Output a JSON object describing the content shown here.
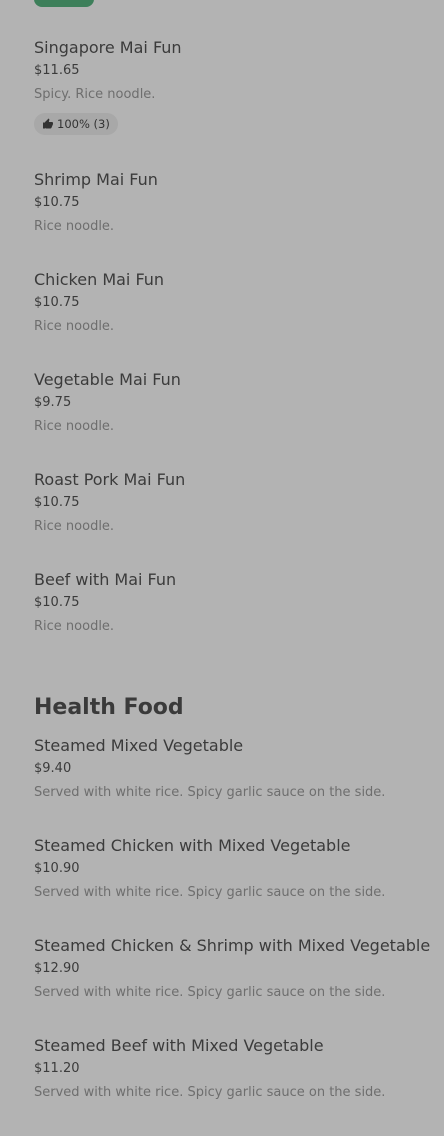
{
  "mai_fun_items": [
    {
      "name": "Singapore Mai Fun",
      "price": "$11.65",
      "description": "Spicy. Rice noodle.",
      "rating": "100% (3)"
    },
    {
      "name": "Shrimp Mai Fun",
      "price": "$10.75",
      "description": "Rice noodle."
    },
    {
      "name": "Chicken Mai Fun",
      "price": "$10.75",
      "description": "Rice noodle."
    },
    {
      "name": "Vegetable Mai Fun",
      "price": "$9.75",
      "description": "Rice noodle."
    },
    {
      "name": "Roast Pork Mai Fun",
      "price": "$10.75",
      "description": "Rice noodle."
    },
    {
      "name": "Beef with Mai Fun",
      "price": "$10.75",
      "description": "Rice noodle."
    }
  ],
  "health_food": {
    "title": "Health Food",
    "items": [
      {
        "name": "Steamed Mixed Vegetable",
        "price": "$9.40",
        "description": "Served with white rice. Spicy garlic sauce on the side."
      },
      {
        "name": "Steamed Chicken with Mixed Vegetable",
        "price": "$10.90",
        "description": "Served with white rice. Spicy garlic sauce on the side."
      },
      {
        "name": "Steamed Chicken & Shrimp with Mixed Vegetable",
        "price": "$12.90",
        "description": "Served with white rice. Spicy garlic sauce on the side."
      },
      {
        "name": "Steamed Beef with Mixed Vegetable",
        "price": "$11.20",
        "description": "Served with white rice. Spicy garlic sauce on the side."
      }
    ]
  },
  "icons": {
    "rating": "thumbs-up-icon"
  },
  "colors": {
    "badge": "#3d7f5a",
    "background": "#b3b3b3"
  }
}
